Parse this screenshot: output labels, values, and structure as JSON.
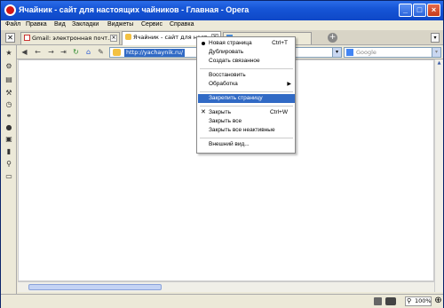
{
  "window": {
    "title": "Ячайник - сайт для настоящих чайников - Главная - Opera",
    "buttons": {
      "minimize": "_",
      "maximize": "□",
      "close": "×"
    }
  },
  "menubar": {
    "items": [
      "Файл",
      "Правка",
      "Вид",
      "Закладки",
      "Виджеты",
      "Сервис",
      "Справка"
    ]
  },
  "tabs": [
    {
      "label": "Gmail: электронная почт...",
      "icon": "gmail-icon"
    },
    {
      "label": "Ячайник - сайт для наст...",
      "icon": "yachaynik-icon",
      "active": true
    },
    {
      "label": "",
      "icon": "page-icon"
    }
  ],
  "addressbar": {
    "url": "http://yachaynik.ru/",
    "search_placeholder": "Google"
  },
  "context_menu": {
    "items": [
      {
        "label": "Новая страница",
        "shortcut": "Ctrl+T",
        "marker": "bullet"
      },
      {
        "label": "Дублировать",
        "shortcut": ""
      },
      {
        "label": "Создать связанное",
        "shortcut": ""
      },
      {
        "label": "Восстановить",
        "shortcut": ""
      },
      {
        "label": "Обработка",
        "shortcut": "",
        "submenu": true
      },
      {
        "label": "Закрепить страницу",
        "shortcut": "",
        "highlighted": true
      },
      {
        "label": "Закрыть",
        "shortcut": "Ctrl+W",
        "marker": "check"
      },
      {
        "label": "Закрыть все",
        "shortcut": ""
      },
      {
        "label": "Закрыть все неактивные",
        "shortcut": ""
      },
      {
        "label": "Внешний вид...",
        "shortcut": ""
      }
    ]
  },
  "statusbar": {
    "zoom": "100%"
  },
  "colors": {
    "titlebar": "#0e47c7",
    "highlight": "#316ac5",
    "chrome": "#ece9d8"
  }
}
